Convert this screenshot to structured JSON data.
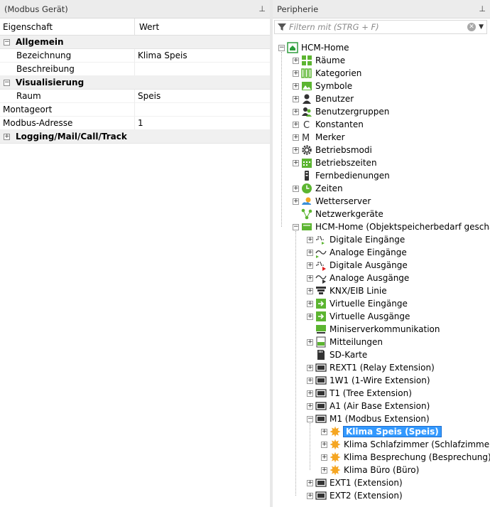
{
  "left_panel": {
    "title": "(Modbus Gerät)",
    "col_property": "Eigenschaft",
    "col_value": "Wert",
    "rows": [
      {
        "kind": "cat",
        "name": "Allgemein",
        "expander": "−"
      },
      {
        "kind": "prop",
        "name": "Bezeichnung",
        "value": "Klima Speis"
      },
      {
        "kind": "prop",
        "name": "Beschreibung",
        "value": ""
      },
      {
        "kind": "cat",
        "name": "Visualisierung",
        "expander": "−"
      },
      {
        "kind": "prop",
        "name": "Raum",
        "value": "Speis"
      },
      {
        "kind": "flat",
        "name": "Montageort",
        "value": ""
      },
      {
        "kind": "flat",
        "name": "Modbus-Adresse",
        "value": "1"
      },
      {
        "kind": "cat",
        "name": "Logging/Mail/Call/Track",
        "expander": "+"
      }
    ]
  },
  "right_panel": {
    "title": "Peripherie",
    "filter_placeholder": "Filtern mit (STRG + F)",
    "tree": [
      {
        "label": "HCM-Home",
        "level": 0,
        "box": "−",
        "icon": "home-device-icon",
        "color": "#2e9e3e"
      },
      {
        "label": "Räume",
        "level": 1,
        "box": "+",
        "icon": "rooms-icon",
        "color": "#5cb531"
      },
      {
        "label": "Kategorien",
        "level": 1,
        "box": "+",
        "icon": "categories-icon",
        "color": "#5cb531"
      },
      {
        "label": "Symbole",
        "level": 1,
        "box": "+",
        "icon": "symbols-icon",
        "color": "#5cb531"
      },
      {
        "label": "Benutzer",
        "level": 1,
        "box": "+",
        "icon": "user-icon",
        "color": "#333333"
      },
      {
        "label": "Benutzergruppen",
        "level": 1,
        "box": "+",
        "icon": "user-group-icon",
        "color": "#333333"
      },
      {
        "label": "Konstanten",
        "level": 1,
        "box": "+",
        "icon": "constants-icon",
        "glyph": "C",
        "color": "#333333"
      },
      {
        "label": "Merker",
        "level": 1,
        "box": "+",
        "icon": "flags-icon",
        "glyph": "M",
        "color": "#333333"
      },
      {
        "label": "Betriebsmodi",
        "level": 1,
        "box": "+",
        "icon": "gear-icon",
        "color": "#333333"
      },
      {
        "label": "Betriebszeiten",
        "level": 1,
        "box": "+",
        "icon": "calendar-icon",
        "color": "#5cb531"
      },
      {
        "label": "Fernbedienungen",
        "level": 1,
        "box": "",
        "icon": "remote-control-icon",
        "color": "#333333"
      },
      {
        "label": "Zeiten",
        "level": 1,
        "box": "+",
        "icon": "clock-icon",
        "color": "#5cb531"
      },
      {
        "label": "Wetterserver",
        "level": 1,
        "box": "+",
        "icon": "weather-icon",
        "color": "#f5a623"
      },
      {
        "label": "Netzwerkgeräte",
        "level": 1,
        "box": "",
        "icon": "network-icon",
        "color": "#5cb531"
      },
      {
        "label": "HCM-Home (Objektspeicherbedarf geschätzt",
        "level": 1,
        "box": "−",
        "icon": "controller-icon",
        "color": "#5cb531"
      },
      {
        "label": "Digitale Eingänge",
        "level": 2,
        "box": "+",
        "icon": "digital-input-icon",
        "color": "#5cb531"
      },
      {
        "label": "Analoge Eingänge",
        "level": 2,
        "box": "+",
        "icon": "analog-input-icon",
        "color": "#5cb531"
      },
      {
        "label": "Digitale Ausgänge",
        "level": 2,
        "box": "+",
        "icon": "digital-output-icon",
        "color": "#e02020"
      },
      {
        "label": "Analoge Ausgänge",
        "level": 2,
        "box": "+",
        "icon": "analog-output-icon",
        "color": "#333333"
      },
      {
        "label": "KNX/EIB Linie",
        "level": 2,
        "box": "+",
        "icon": "knx-icon",
        "color": "#333333"
      },
      {
        "label": "Virtuelle Eingänge",
        "level": 2,
        "box": "+",
        "icon": "virtual-input-icon",
        "color": "#5cb531"
      },
      {
        "label": "Virtuelle Ausgänge",
        "level": 2,
        "box": "+",
        "icon": "virtual-output-icon",
        "color": "#5cb531"
      },
      {
        "label": "Miniserverkommunikation",
        "level": 2,
        "box": "",
        "icon": "miniserver-icon",
        "color": "#5cb531"
      },
      {
        "label": "Mitteilungen",
        "level": 2,
        "box": "+",
        "icon": "messages-icon",
        "color": "#5cb531"
      },
      {
        "label": "SD-Karte",
        "level": 2,
        "box": "",
        "icon": "sd-card-icon",
        "color": "#333333"
      },
      {
        "label": "REXT1 (Relay Extension)",
        "level": 2,
        "box": "+",
        "icon": "extension-icon",
        "color": "#333333"
      },
      {
        "label": "1W1 (1-Wire Extension)",
        "level": 2,
        "box": "+",
        "icon": "extension-icon",
        "color": "#333333"
      },
      {
        "label": "T1 (Tree Extension)",
        "level": 2,
        "box": "+",
        "icon": "extension-icon",
        "color": "#333333"
      },
      {
        "label": "A1 (Air Base Extension)",
        "level": 2,
        "box": "+",
        "icon": "extension-icon",
        "color": "#333333"
      },
      {
        "label": "M1 (Modbus Extension)",
        "level": 2,
        "box": "−",
        "icon": "extension-icon",
        "color": "#333333"
      },
      {
        "label": "Klima Speis (Speis)",
        "level": 3,
        "box": "+",
        "icon": "modbus-device-icon",
        "color": "#f5a623",
        "selected": true
      },
      {
        "label": "Klima Schlafzimmer (Schlafzimmer)",
        "level": 3,
        "box": "+",
        "icon": "modbus-device-icon",
        "color": "#f5a623"
      },
      {
        "label": "Klima Besprechung (Besprechung)",
        "level": 3,
        "box": "+",
        "icon": "modbus-device-icon",
        "color": "#f5a623"
      },
      {
        "label": "Klima Büro (Büro)",
        "level": 3,
        "box": "+",
        "icon": "modbus-device-icon",
        "color": "#f5a623"
      },
      {
        "label": "EXT1 (Extension)",
        "level": 2,
        "box": "+",
        "icon": "extension-icon",
        "color": "#333333"
      },
      {
        "label": "EXT2 (Extension)",
        "level": 2,
        "box": "+",
        "icon": "extension-icon",
        "color": "#333333"
      }
    ]
  }
}
